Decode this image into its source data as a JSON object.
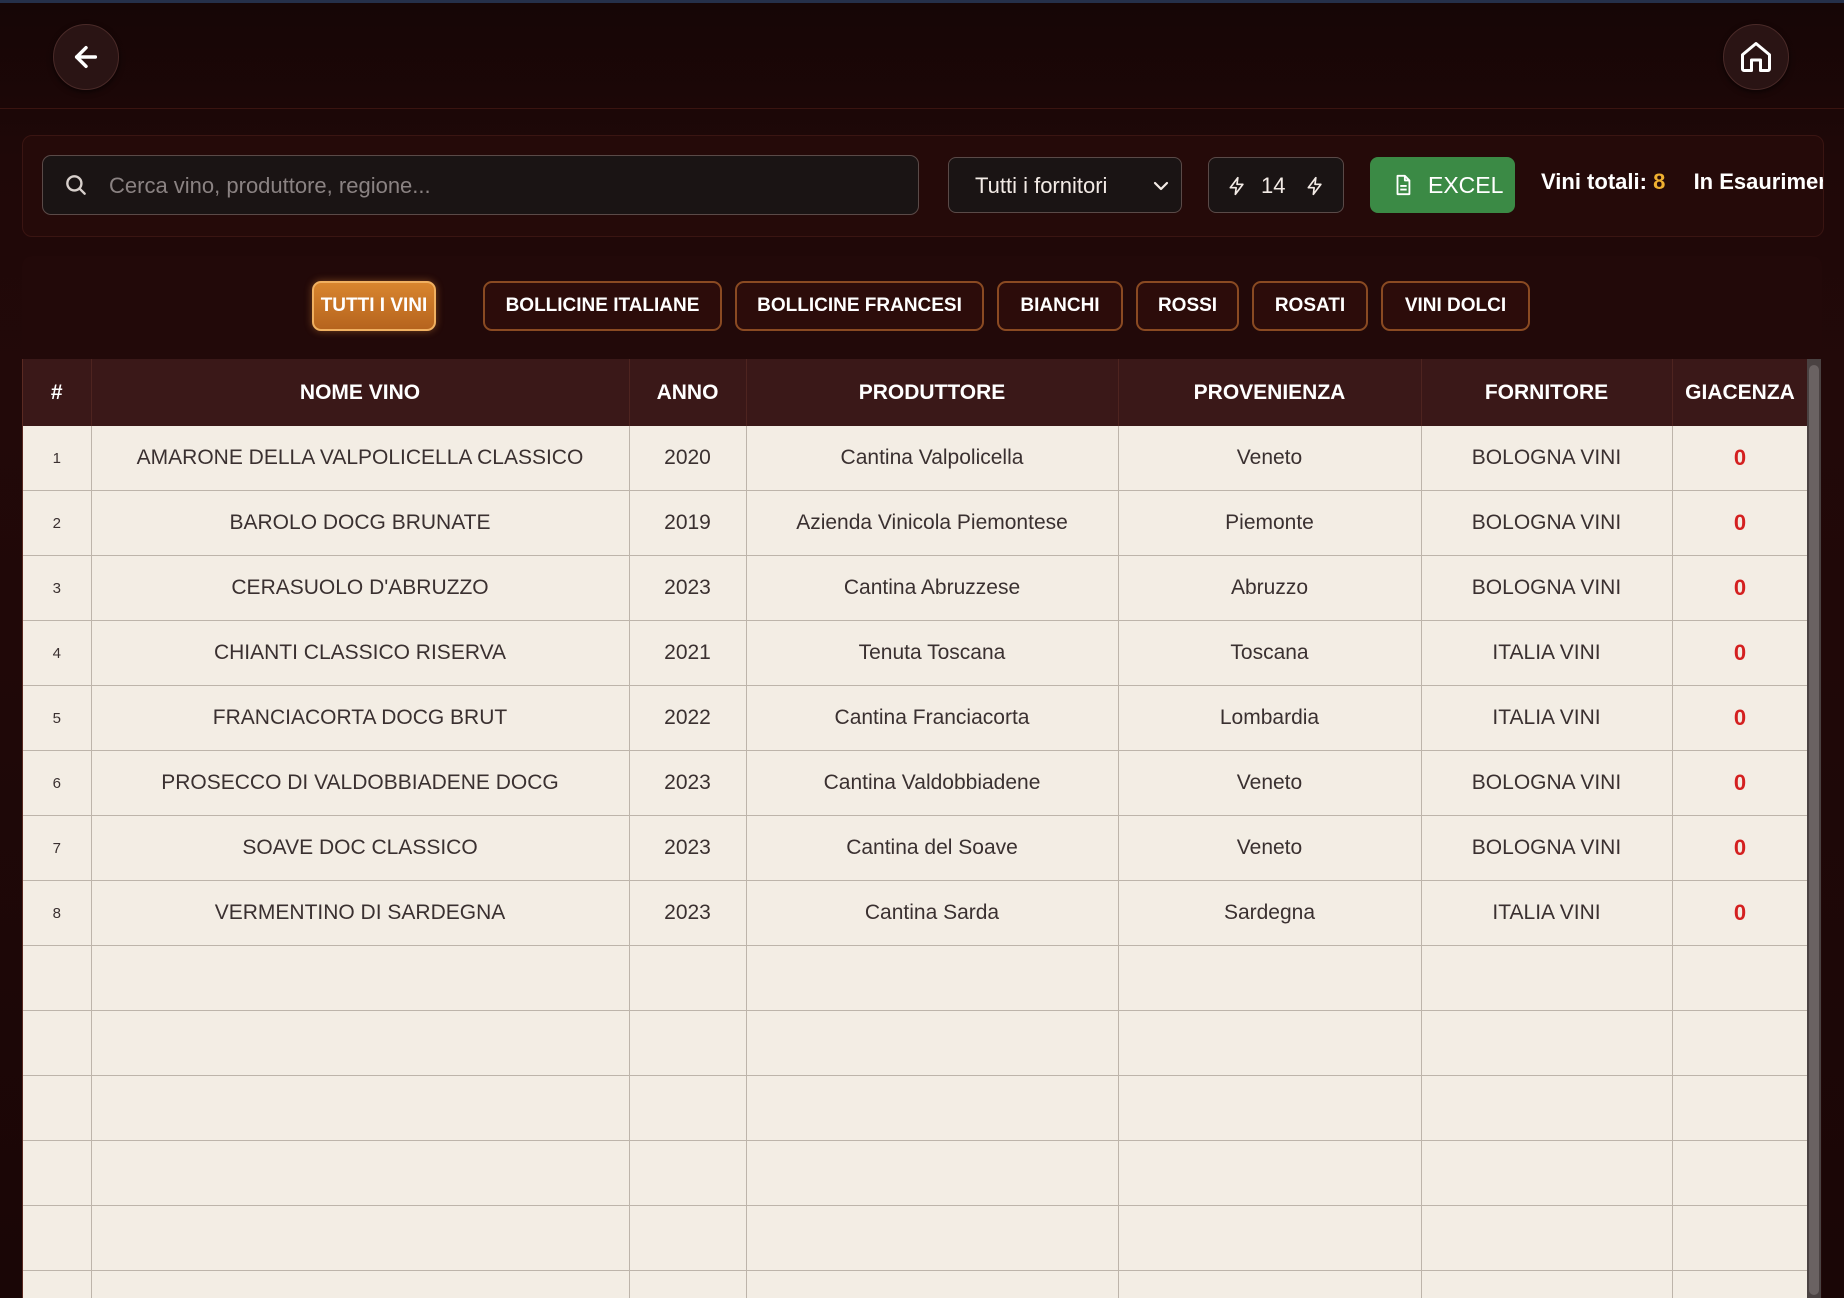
{
  "search": {
    "placeholder": "Cerca vino, produttore, regione...",
    "value": ""
  },
  "supplier_select": {
    "selected": "Tutti i fornitori"
  },
  "stepper": {
    "value": "14"
  },
  "excel": {
    "label": "EXCEL"
  },
  "stats": {
    "totals_label": "Vini totali:",
    "totals_value": "8",
    "low_stock_label": "In Esaurimento"
  },
  "categories": [
    {
      "label": "TUTTI I VINI",
      "active": true
    },
    {
      "label": "BOLLICINE ITALIANE",
      "active": false
    },
    {
      "label": "BOLLICINE FRANCESI",
      "active": false
    },
    {
      "label": "BIANCHI",
      "active": false
    },
    {
      "label": "ROSSI",
      "active": false
    },
    {
      "label": "ROSATI",
      "active": false
    },
    {
      "label": "VINI DOLCI",
      "active": false
    }
  ],
  "table": {
    "headers": [
      "#",
      "NOME VINO",
      "ANNO",
      "PRODUTTORE",
      "PROVENIENZA",
      "FORNITORE",
      "GIACENZA"
    ],
    "rows": [
      [
        "1",
        "AMARONE DELLA VALPOLICELLA CLASSICO",
        "2020",
        "Cantina Valpolicella",
        "Veneto",
        "BOLOGNA VINI",
        "0"
      ],
      [
        "2",
        "BAROLO DOCG BRUNATE",
        "2019",
        "Azienda Vinicola Piemontese",
        "Piemonte",
        "BOLOGNA VINI",
        "0"
      ],
      [
        "3",
        "CERASUOLO D'ABRUZZO",
        "2023",
        "Cantina Abruzzese",
        "Abruzzo",
        "BOLOGNA VINI",
        "0"
      ],
      [
        "4",
        "CHIANTI CLASSICO RISERVA",
        "2021",
        "Tenuta Toscana",
        "Toscana",
        "ITALIA VINI",
        "0"
      ],
      [
        "5",
        "FRANCIACORTA DOCG BRUT",
        "2022",
        "Cantina Franciacorta",
        "Lombardia",
        "ITALIA VINI",
        "0"
      ],
      [
        "6",
        "PROSECCO DI VALDOBBIADENE DOCG",
        "2023",
        "Cantina Valdobbiadene",
        "Veneto",
        "BOLOGNA VINI",
        "0"
      ],
      [
        "7",
        "SOAVE DOC CLASSICO",
        "2023",
        "Cantina del Soave",
        "Veneto",
        "BOLOGNA VINI",
        "0"
      ],
      [
        "8",
        "VERMENTINO DI SARDEGNA",
        "2023",
        "Cantina Sarda",
        "Sardegna",
        "ITALIA VINI",
        "0"
      ]
    ],
    "empty_rows": 6
  },
  "colors": {
    "accent": "#d8852e",
    "excel_green": "#3b8a45",
    "stock_zero": "#d42020",
    "highlight": "#f0b030"
  }
}
